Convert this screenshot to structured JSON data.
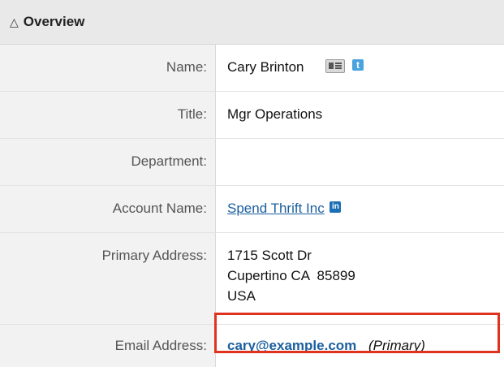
{
  "panel": {
    "title": "Overview",
    "collapse_icon": "double-chevron-up-icon"
  },
  "fields": {
    "name": {
      "label": "Name:",
      "value": "Cary Brinton",
      "icons": [
        "vcard-icon",
        "twitter-icon"
      ]
    },
    "title": {
      "label": "Title:",
      "value": "Mgr Operations"
    },
    "department": {
      "label": "Department:",
      "value": ""
    },
    "account": {
      "label": "Account Name:",
      "value": "Spend Thrift Inc",
      "icon": "linkedin-icon"
    },
    "address": {
      "label": "Primary Address:",
      "lines": [
        "1715 Scott Dr",
        "Cupertino CA  85899",
        "USA"
      ]
    },
    "email": {
      "label": "Email Address:",
      "value": "cary@example.com",
      "tag": "(Primary)"
    }
  },
  "colors": {
    "highlight_border": "#e0331f",
    "link": "#1b5f9e",
    "label_bg": "#f2f2f2",
    "header_bg": "#e9e9e9"
  }
}
